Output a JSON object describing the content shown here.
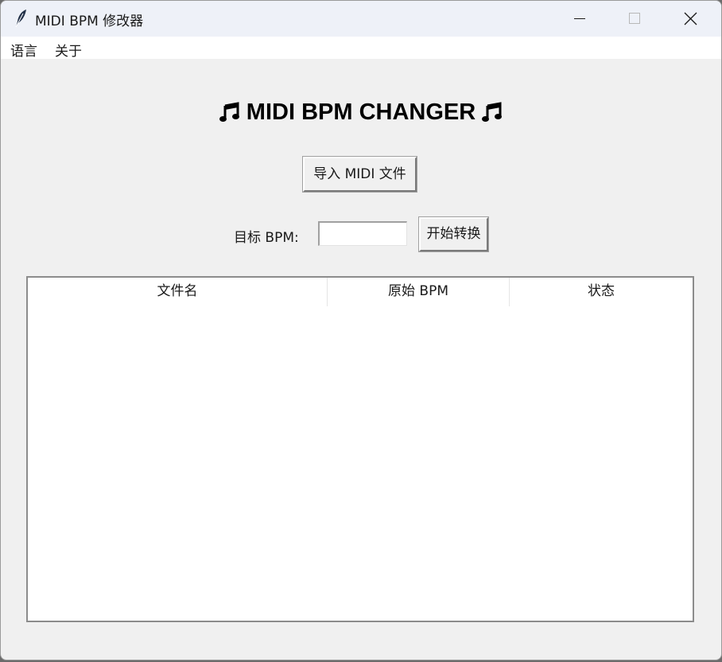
{
  "window": {
    "title": "MIDI BPM 修改器",
    "controls": {
      "minimize": "minimize",
      "maximize": "maximize",
      "close": "close"
    }
  },
  "menu": {
    "language": "语言",
    "about": "关于"
  },
  "main": {
    "heading": "MIDI BPM CHANGER",
    "heading_icon": "music-note-icon",
    "import_button": "导入 MIDI 文件",
    "bpm_label": "目标 BPM:",
    "bpm_value": "",
    "convert_button": "开始转换"
  },
  "table": {
    "columns": [
      "文件名",
      "原始 BPM",
      "状态"
    ],
    "rows": []
  }
}
